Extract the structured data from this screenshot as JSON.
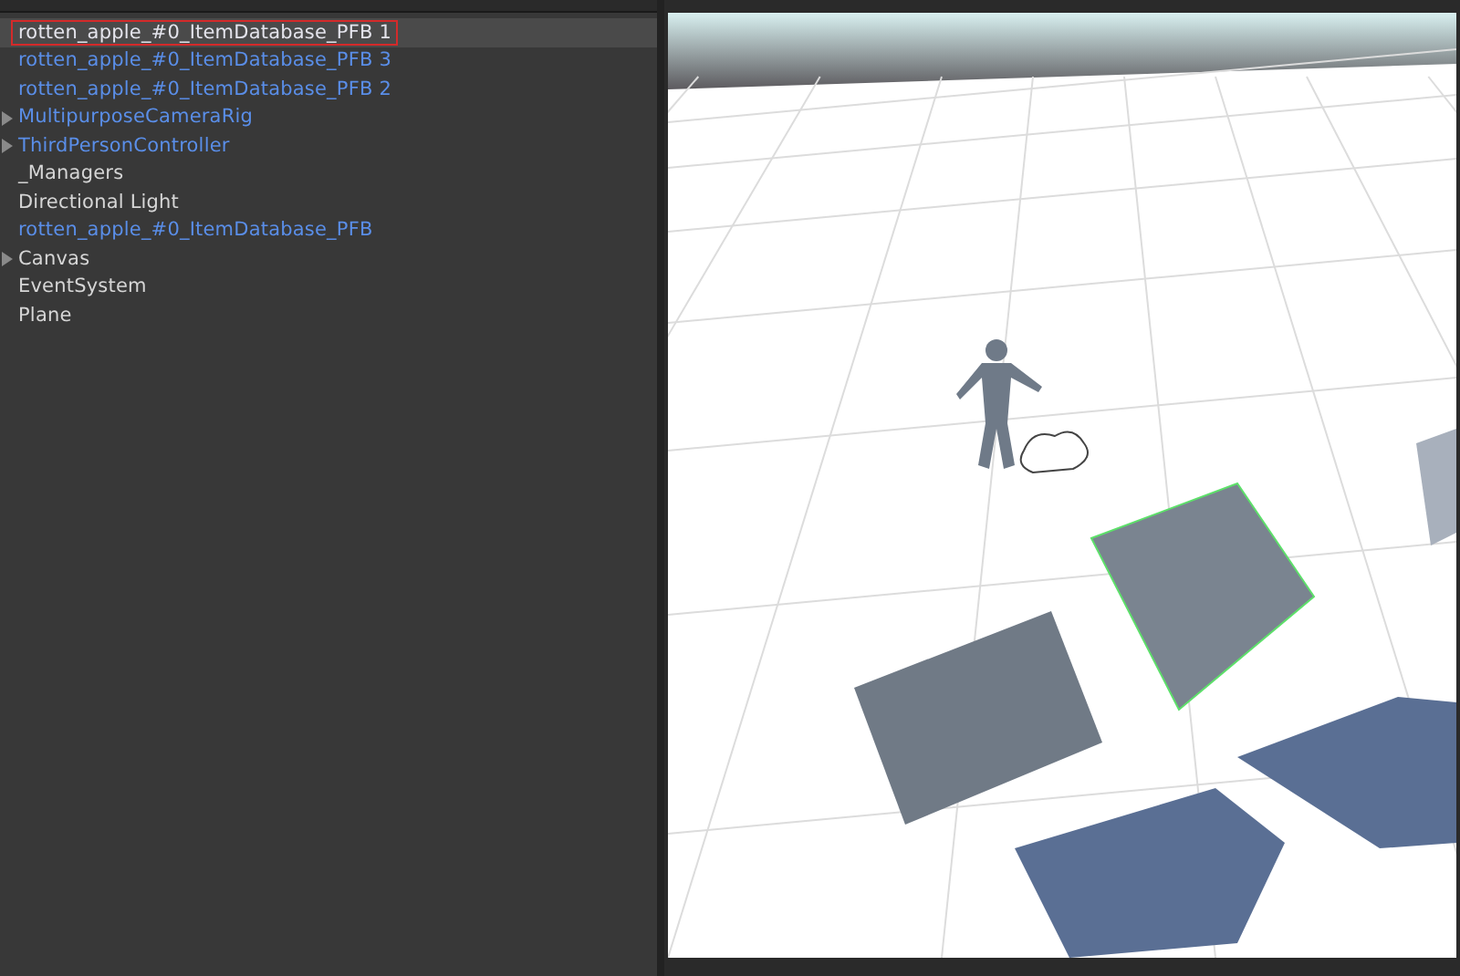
{
  "hierarchy": {
    "items": [
      {
        "label": "rotten_apple_#0_ItemDatabase_PFB 1",
        "kind": "prefab",
        "has_children": false,
        "selected": true
      },
      {
        "label": "rotten_apple_#0_ItemDatabase_PFB 3",
        "kind": "prefab",
        "has_children": false,
        "selected": false
      },
      {
        "label": "rotten_apple_#0_ItemDatabase_PFB 2",
        "kind": "prefab",
        "has_children": false,
        "selected": false
      },
      {
        "label": "MultipurposeCameraRig",
        "kind": "prefab",
        "has_children": true,
        "selected": false
      },
      {
        "label": "ThirdPersonController",
        "kind": "prefab",
        "has_children": true,
        "selected": false
      },
      {
        "label": "_Managers",
        "kind": "object",
        "has_children": false,
        "selected": false
      },
      {
        "label": "Directional Light",
        "kind": "object",
        "has_children": false,
        "selected": false
      },
      {
        "label": "rotten_apple_#0_ItemDatabase_PFB",
        "kind": "prefab",
        "has_children": false,
        "selected": false
      },
      {
        "label": "Canvas",
        "kind": "object",
        "has_children": true,
        "selected": false
      },
      {
        "label": "EventSystem",
        "kind": "object",
        "has_children": false,
        "selected": false
      },
      {
        "label": "Plane",
        "kind": "object",
        "has_children": false,
        "selected": false
      }
    ]
  }
}
